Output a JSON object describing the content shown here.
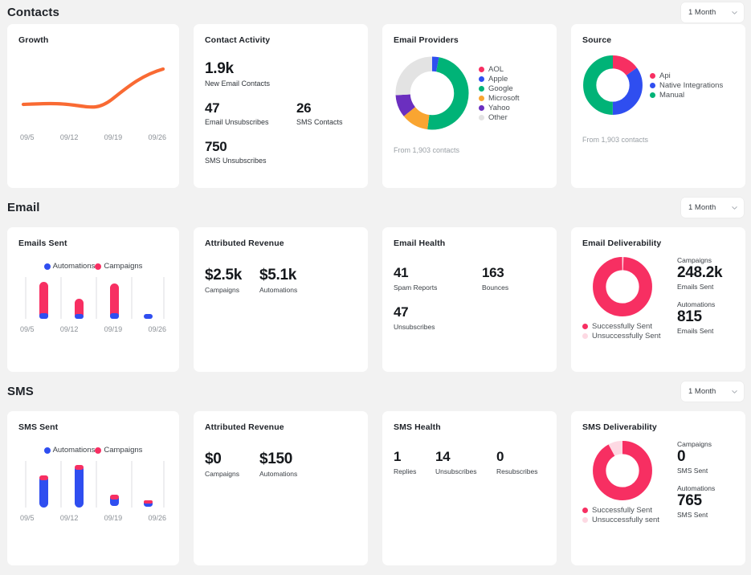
{
  "colors": {
    "background": "#f2f2f2",
    "card": "#ffffff",
    "pink": "#f72f62",
    "pink_light": "#fdd9e3",
    "blue": "#2f4ef0",
    "green": "#00b377",
    "orange_chart": "#f9a531",
    "purple": "#6b2fbf",
    "grey": "#e3e3e3",
    "orange_line": "#f96a33",
    "text": "#20242a",
    "muted": "#8b9096"
  },
  "sections": [
    {
      "title": "Contacts",
      "period": {
        "label": "1 Month",
        "icon": "chevron-down-icon"
      }
    },
    {
      "title": "Email",
      "period": {
        "label": "1 Month",
        "icon": "chevron-down-icon"
      }
    },
    {
      "title": "SMS",
      "period": {
        "label": "1 Month",
        "icon": "chevron-down-icon"
      }
    }
  ],
  "growth": {
    "title": "Growth",
    "axis": [
      "09/5",
      "09/12",
      "09/19",
      "09/26"
    ]
  },
  "contact_activity": {
    "title": "Contact Activity",
    "primary": {
      "value": "1.9k",
      "label": "New Email Contacts"
    },
    "stats": [
      {
        "value": "47",
        "label": "Email Unsubscribes"
      },
      {
        "value": "26",
        "label": "SMS Contacts"
      }
    ],
    "bottom": {
      "value": "750",
      "label": "SMS Unsubscribes"
    }
  },
  "email_providers": {
    "title": "Email Providers",
    "footnote": "From 1,903 contacts",
    "legend": [
      {
        "label": "AOL",
        "color": "#f72f62"
      },
      {
        "label": "Apple",
        "color": "#2f4ef0"
      },
      {
        "label": "Google",
        "color": "#00b377"
      },
      {
        "label": "Microsoft",
        "color": "#f9a531"
      },
      {
        "label": "Yahoo",
        "color": "#6b2fbf"
      },
      {
        "label": "Other",
        "color": "#e3e3e3"
      }
    ]
  },
  "source": {
    "title": "Source",
    "footnote": "From 1,903 contacts",
    "legend": [
      {
        "label": "Api",
        "color": "#f72f62"
      },
      {
        "label": "Native Integrations",
        "color": "#2f4ef0"
      },
      {
        "label": "Manual",
        "color": "#00b377"
      }
    ]
  },
  "emails_sent": {
    "title": "Emails Sent",
    "legend": [
      {
        "label": "Automations",
        "color": "#2f4ef0"
      },
      {
        "label": "Campaigns",
        "color": "#f72f62"
      }
    ],
    "axis": [
      "09/5",
      "09/12",
      "09/19",
      "09/26"
    ]
  },
  "email_revenue": {
    "title": "Attributed Revenue",
    "stats": [
      {
        "value": "$2.5k",
        "label": "Campaigns"
      },
      {
        "value": "$5.1k",
        "label": "Automations"
      }
    ]
  },
  "email_health": {
    "title": "Email Health",
    "stats": [
      {
        "value": "41",
        "label": "Spam Reports"
      },
      {
        "value": "163",
        "label": "Bounces"
      }
    ],
    "bottom": {
      "value": "47",
      "label": "Unsubscribes"
    }
  },
  "email_deliverability": {
    "title": "Email Deliverability",
    "legend": [
      {
        "label": "Successfully Sent",
        "color": "#f72f62"
      },
      {
        "label": "Unsuccessfully Sent",
        "color": "#fdd9e3"
      }
    ],
    "stats": [
      {
        "group": "Campaigns",
        "value": "248.2k",
        "label": "Emails Sent"
      },
      {
        "group": "Automations",
        "value": "815",
        "label": "Emails Sent"
      }
    ]
  },
  "sms_sent": {
    "title": "SMS Sent",
    "legend": [
      {
        "label": "Automations",
        "color": "#2f4ef0"
      },
      {
        "label": "Campaigns",
        "color": "#f72f62"
      }
    ],
    "axis": [
      "09/5",
      "09/12",
      "09/19",
      "09/26"
    ]
  },
  "sms_revenue": {
    "title": "Attributed Revenue",
    "stats": [
      {
        "value": "$0",
        "label": "Campaigns"
      },
      {
        "value": "$150",
        "label": "Automations"
      }
    ]
  },
  "sms_health": {
    "title": "SMS Health",
    "stats": [
      {
        "value": "1",
        "label": "Replies"
      },
      {
        "value": "14",
        "label": "Unsubscribes"
      },
      {
        "value": "0",
        "label": "Resubscribes"
      }
    ]
  },
  "sms_deliverability": {
    "title": "SMS Deliverability",
    "legend": [
      {
        "label": "Successfully Sent",
        "color": "#f72f62"
      },
      {
        "label": "Unsuccessfully sent",
        "color": "#fdd9e3"
      }
    ],
    "stats": [
      {
        "group": "Campaigns",
        "value": "0",
        "label": "SMS Sent"
      },
      {
        "group": "Automations",
        "value": "765",
        "label": "SMS Sent"
      }
    ]
  },
  "chart_data": [
    {
      "type": "line",
      "name": "growth-sparkline",
      "title": "Growth",
      "x": [
        "09/5",
        "09/12",
        "09/19",
        "09/26"
      ],
      "values": [
        30,
        31,
        27,
        78
      ],
      "ylim": [
        0,
        100
      ],
      "grid": false,
      "color": "#f96a33"
    },
    {
      "type": "pie",
      "name": "email-providers-donut",
      "title": "Email Providers",
      "categories": [
        "AOL",
        "Apple",
        "Google",
        "Microsoft",
        "Yahoo",
        "Other"
      ],
      "values": [
        0,
        3,
        49,
        12,
        10,
        26
      ],
      "colors": [
        "#f72f62",
        "#2f4ef0",
        "#00b377",
        "#f9a531",
        "#6b2fbf",
        "#e3e3e3"
      ],
      "legend": "right",
      "annotation": "From 1,903 contacts"
    },
    {
      "type": "pie",
      "name": "source-donut",
      "title": "Source",
      "categories": [
        "Api",
        "Native Integrations",
        "Manual"
      ],
      "values": [
        15,
        35,
        50
      ],
      "colors": [
        "#f72f62",
        "#2f4ef0",
        "#00b377"
      ],
      "legend": "right",
      "annotation": "From 1,903 contacts"
    },
    {
      "type": "bar",
      "name": "emails-sent-bars",
      "title": "Emails Sent",
      "categories": [
        "09/5",
        "09/12",
        "09/19",
        "09/26"
      ],
      "series": [
        {
          "name": "Campaigns",
          "values": [
            88,
            40,
            84,
            0
          ],
          "color": "#f72f62"
        },
        {
          "name": "Automations",
          "values": [
            8,
            6,
            7,
            6
          ],
          "color": "#2f4ef0"
        }
      ],
      "ylim": [
        0,
        100
      ],
      "stacked": true,
      "legend": "top"
    },
    {
      "type": "pie",
      "name": "email-deliverability-donut",
      "title": "Email Deliverability",
      "categories": [
        "Successfully Sent",
        "Unsuccessfully Sent"
      ],
      "values": [
        99,
        1
      ],
      "colors": [
        "#f72f62",
        "#fdd9e3"
      ],
      "legend": "bottom"
    },
    {
      "type": "bar",
      "name": "sms-sent-bars",
      "title": "SMS Sent",
      "categories": [
        "09/5",
        "09/12",
        "09/19",
        "09/26"
      ],
      "series": [
        {
          "name": "Automations",
          "values": [
            56,
            82,
            12,
            7
          ],
          "color": "#2f4ef0"
        },
        {
          "name": "Campaigns",
          "values": [
            8,
            7,
            8,
            4
          ],
          "color": "#f72f62"
        }
      ],
      "ylim": [
        0,
        100
      ],
      "stacked": true,
      "legend": "top"
    },
    {
      "type": "pie",
      "name": "sms-deliverability-donut",
      "title": "SMS Deliverability",
      "categories": [
        "Successfully Sent",
        "Unsuccessfully sent"
      ],
      "values": [
        92,
        8
      ],
      "colors": [
        "#f72f62",
        "#fdd9e3"
      ],
      "legend": "bottom"
    }
  ]
}
